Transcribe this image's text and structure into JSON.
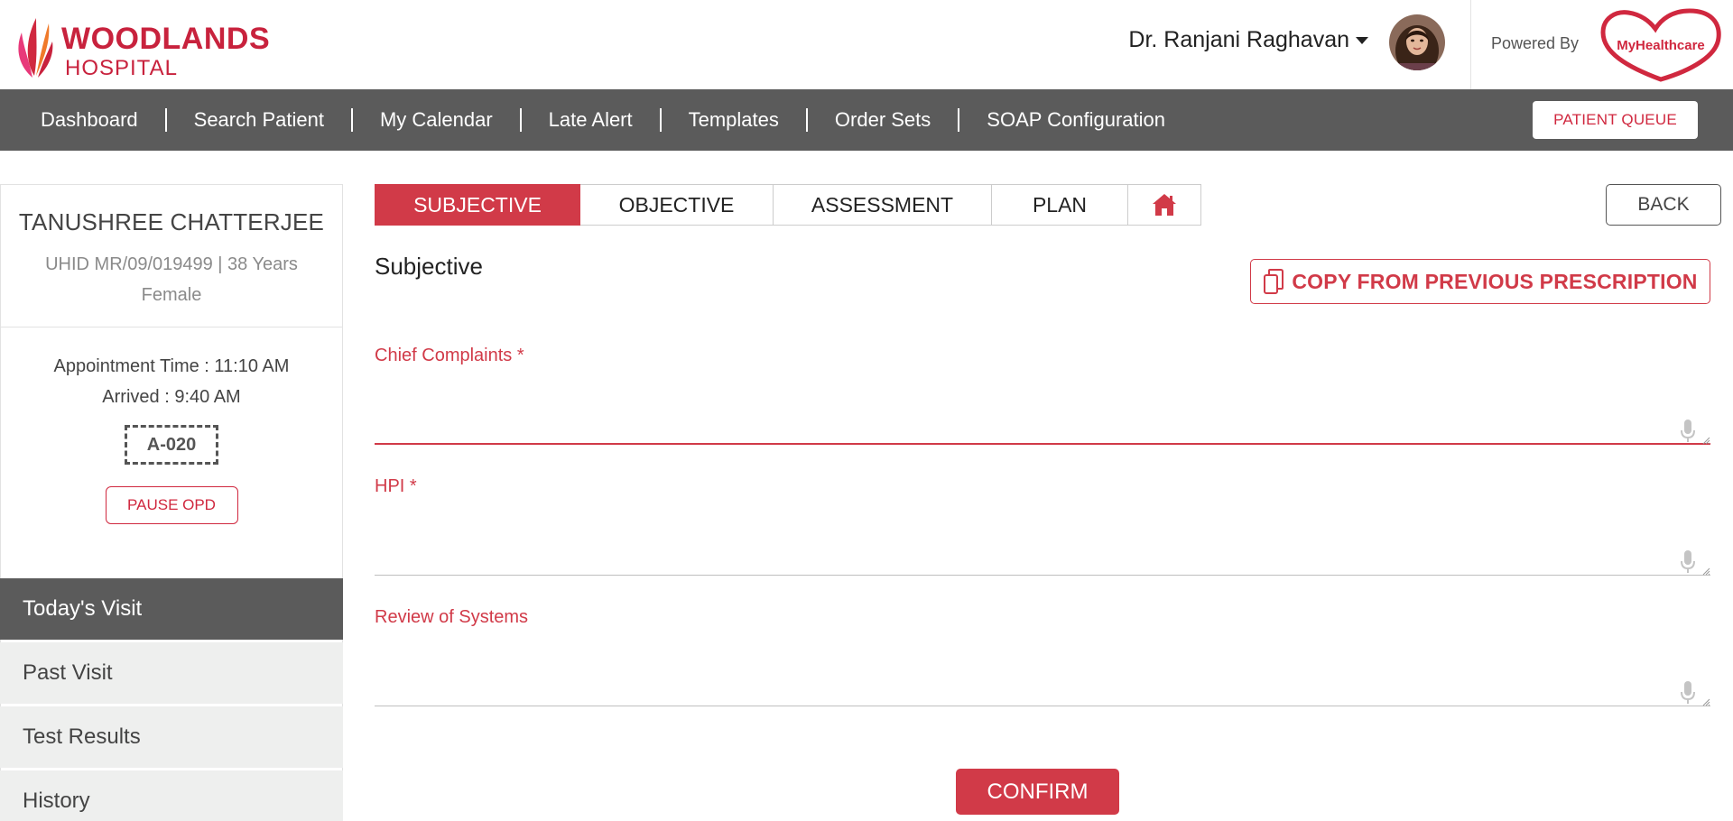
{
  "header": {
    "logo_line1": "WOODLANDS",
    "logo_line2": "HOSPITAL",
    "user_name": "Dr. Ranjani Raghavan",
    "powered_by": "Powered By",
    "partner_logo_text": "MyHealthcare",
    "brand_color": "#c8223d"
  },
  "nav": {
    "items": [
      "Dashboard",
      "Search Patient",
      "My Calendar",
      "Late Alert",
      "Templates",
      "Order Sets",
      "SOAP Configuration"
    ],
    "queue_button": "PATIENT QUEUE"
  },
  "patient": {
    "name": "TANUSHREE CHATTERJEE",
    "meta_line1": "UHID MR/09/019499 | 38 Years",
    "meta_line2": "Female",
    "appointment_time": "Appointment Time : 11:10 AM",
    "arrived": "Arrived : 9:40 AM",
    "token": "A-020",
    "pause_button": "PAUSE OPD"
  },
  "side_menu": {
    "items": [
      "Today's Visit",
      "Past Visit",
      "Test Results",
      "History"
    ],
    "active_index": 0
  },
  "tabs": {
    "items": [
      "SUBJECTIVE",
      "OBJECTIVE",
      "ASSESSMENT",
      "PLAN"
    ],
    "active_index": 0,
    "home_icon": "home-icon",
    "back_button": "BACK"
  },
  "subjective": {
    "title": "Subjective",
    "copy_button": "COPY FROM PREVIOUS PRESCRIPTION",
    "fields": [
      {
        "label": "Chief Complaints *",
        "value": ""
      },
      {
        "label": "HPI *",
        "value": ""
      },
      {
        "label": "Review of Systems",
        "value": ""
      }
    ],
    "confirm_button": "CONFIRM"
  },
  "colors": {
    "accent": "#d13a48",
    "nav_bg": "#5b5b5b",
    "side_bg": "#eeefee"
  }
}
